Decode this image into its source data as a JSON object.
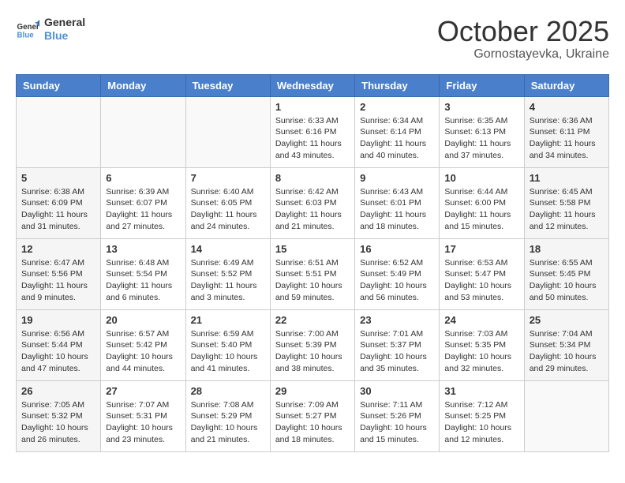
{
  "header": {
    "logo_line1": "General",
    "logo_line2": "Blue",
    "month": "October 2025",
    "location": "Gornostayevka, Ukraine"
  },
  "weekdays": [
    "Sunday",
    "Monday",
    "Tuesday",
    "Wednesday",
    "Thursday",
    "Friday",
    "Saturday"
  ],
  "weeks": [
    [
      {
        "day": "",
        "info": ""
      },
      {
        "day": "",
        "info": ""
      },
      {
        "day": "",
        "info": ""
      },
      {
        "day": "1",
        "info": "Sunrise: 6:33 AM\nSunset: 6:16 PM\nDaylight: 11 hours\nand 43 minutes."
      },
      {
        "day": "2",
        "info": "Sunrise: 6:34 AM\nSunset: 6:14 PM\nDaylight: 11 hours\nand 40 minutes."
      },
      {
        "day": "3",
        "info": "Sunrise: 6:35 AM\nSunset: 6:13 PM\nDaylight: 11 hours\nand 37 minutes."
      },
      {
        "day": "4",
        "info": "Sunrise: 6:36 AM\nSunset: 6:11 PM\nDaylight: 11 hours\nand 34 minutes."
      }
    ],
    [
      {
        "day": "5",
        "info": "Sunrise: 6:38 AM\nSunset: 6:09 PM\nDaylight: 11 hours\nand 31 minutes."
      },
      {
        "day": "6",
        "info": "Sunrise: 6:39 AM\nSunset: 6:07 PM\nDaylight: 11 hours\nand 27 minutes."
      },
      {
        "day": "7",
        "info": "Sunrise: 6:40 AM\nSunset: 6:05 PM\nDaylight: 11 hours\nand 24 minutes."
      },
      {
        "day": "8",
        "info": "Sunrise: 6:42 AM\nSunset: 6:03 PM\nDaylight: 11 hours\nand 21 minutes."
      },
      {
        "day": "9",
        "info": "Sunrise: 6:43 AM\nSunset: 6:01 PM\nDaylight: 11 hours\nand 18 minutes."
      },
      {
        "day": "10",
        "info": "Sunrise: 6:44 AM\nSunset: 6:00 PM\nDaylight: 11 hours\nand 15 minutes."
      },
      {
        "day": "11",
        "info": "Sunrise: 6:45 AM\nSunset: 5:58 PM\nDaylight: 11 hours\nand 12 minutes."
      }
    ],
    [
      {
        "day": "12",
        "info": "Sunrise: 6:47 AM\nSunset: 5:56 PM\nDaylight: 11 hours\nand 9 minutes."
      },
      {
        "day": "13",
        "info": "Sunrise: 6:48 AM\nSunset: 5:54 PM\nDaylight: 11 hours\nand 6 minutes."
      },
      {
        "day": "14",
        "info": "Sunrise: 6:49 AM\nSunset: 5:52 PM\nDaylight: 11 hours\nand 3 minutes."
      },
      {
        "day": "15",
        "info": "Sunrise: 6:51 AM\nSunset: 5:51 PM\nDaylight: 10 hours\nand 59 minutes."
      },
      {
        "day": "16",
        "info": "Sunrise: 6:52 AM\nSunset: 5:49 PM\nDaylight: 10 hours\nand 56 minutes."
      },
      {
        "day": "17",
        "info": "Sunrise: 6:53 AM\nSunset: 5:47 PM\nDaylight: 10 hours\nand 53 minutes."
      },
      {
        "day": "18",
        "info": "Sunrise: 6:55 AM\nSunset: 5:45 PM\nDaylight: 10 hours\nand 50 minutes."
      }
    ],
    [
      {
        "day": "19",
        "info": "Sunrise: 6:56 AM\nSunset: 5:44 PM\nDaylight: 10 hours\nand 47 minutes."
      },
      {
        "day": "20",
        "info": "Sunrise: 6:57 AM\nSunset: 5:42 PM\nDaylight: 10 hours\nand 44 minutes."
      },
      {
        "day": "21",
        "info": "Sunrise: 6:59 AM\nSunset: 5:40 PM\nDaylight: 10 hours\nand 41 minutes."
      },
      {
        "day": "22",
        "info": "Sunrise: 7:00 AM\nSunset: 5:39 PM\nDaylight: 10 hours\nand 38 minutes."
      },
      {
        "day": "23",
        "info": "Sunrise: 7:01 AM\nSunset: 5:37 PM\nDaylight: 10 hours\nand 35 minutes."
      },
      {
        "day": "24",
        "info": "Sunrise: 7:03 AM\nSunset: 5:35 PM\nDaylight: 10 hours\nand 32 minutes."
      },
      {
        "day": "25",
        "info": "Sunrise: 7:04 AM\nSunset: 5:34 PM\nDaylight: 10 hours\nand 29 minutes."
      }
    ],
    [
      {
        "day": "26",
        "info": "Sunrise: 7:05 AM\nSunset: 5:32 PM\nDaylight: 10 hours\nand 26 minutes."
      },
      {
        "day": "27",
        "info": "Sunrise: 7:07 AM\nSunset: 5:31 PM\nDaylight: 10 hours\nand 23 minutes."
      },
      {
        "day": "28",
        "info": "Sunrise: 7:08 AM\nSunset: 5:29 PM\nDaylight: 10 hours\nand 21 minutes."
      },
      {
        "day": "29",
        "info": "Sunrise: 7:09 AM\nSunset: 5:27 PM\nDaylight: 10 hours\nand 18 minutes."
      },
      {
        "day": "30",
        "info": "Sunrise: 7:11 AM\nSunset: 5:26 PM\nDaylight: 10 hours\nand 15 minutes."
      },
      {
        "day": "31",
        "info": "Sunrise: 7:12 AM\nSunset: 5:25 PM\nDaylight: 10 hours\nand 12 minutes."
      },
      {
        "day": "",
        "info": ""
      }
    ]
  ]
}
